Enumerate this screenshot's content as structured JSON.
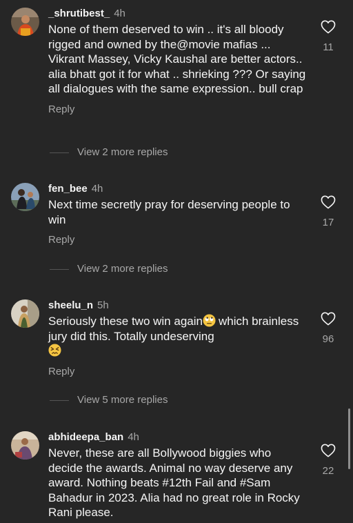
{
  "comments": [
    {
      "username": "_shrutibest_",
      "time": "4h",
      "text": "None of them deserved to win .. it's all bloody rigged and owned by the@movie mafias ... Vikrant Massey, Vicky Kaushal are better actors.. alia bhatt got it for what .. shrieking ??? Or saying all dialogues with the same expression.. bull crap",
      "reply_label": "Reply",
      "more_replies": "View 2 more replies",
      "likes": "11"
    },
    {
      "username": "fen_bee",
      "time": "4h",
      "text": "Next time secretly pray for deserving people to win",
      "reply_label": "Reply",
      "more_replies": "View 2 more replies",
      "likes": "17"
    },
    {
      "username": "sheelu_n",
      "time": "5h",
      "text_part1": "Seriously these two win again",
      "emoji1": "face-with-rolling-eyes-icon",
      "text_part2": "which brainless jury did this. Totally undeserving",
      "emoji2": "confounded-face-icon",
      "reply_label": "Reply",
      "more_replies": "View 5 more replies",
      "likes": "96"
    },
    {
      "username": "abhideepa_ban",
      "time": "4h",
      "text": "Never, these are all Bollywood biggies who decide the awards. Animal no way deserve any award. Nothing beats #12th Fail and #Sam Bahadur in 2023. Alia had no great role in Rocky Rani please.",
      "likes": "22"
    }
  ],
  "colors": {
    "background": "#262626",
    "primary_text": "#f5f5f5",
    "secondary_text": "#a8a8a8"
  }
}
